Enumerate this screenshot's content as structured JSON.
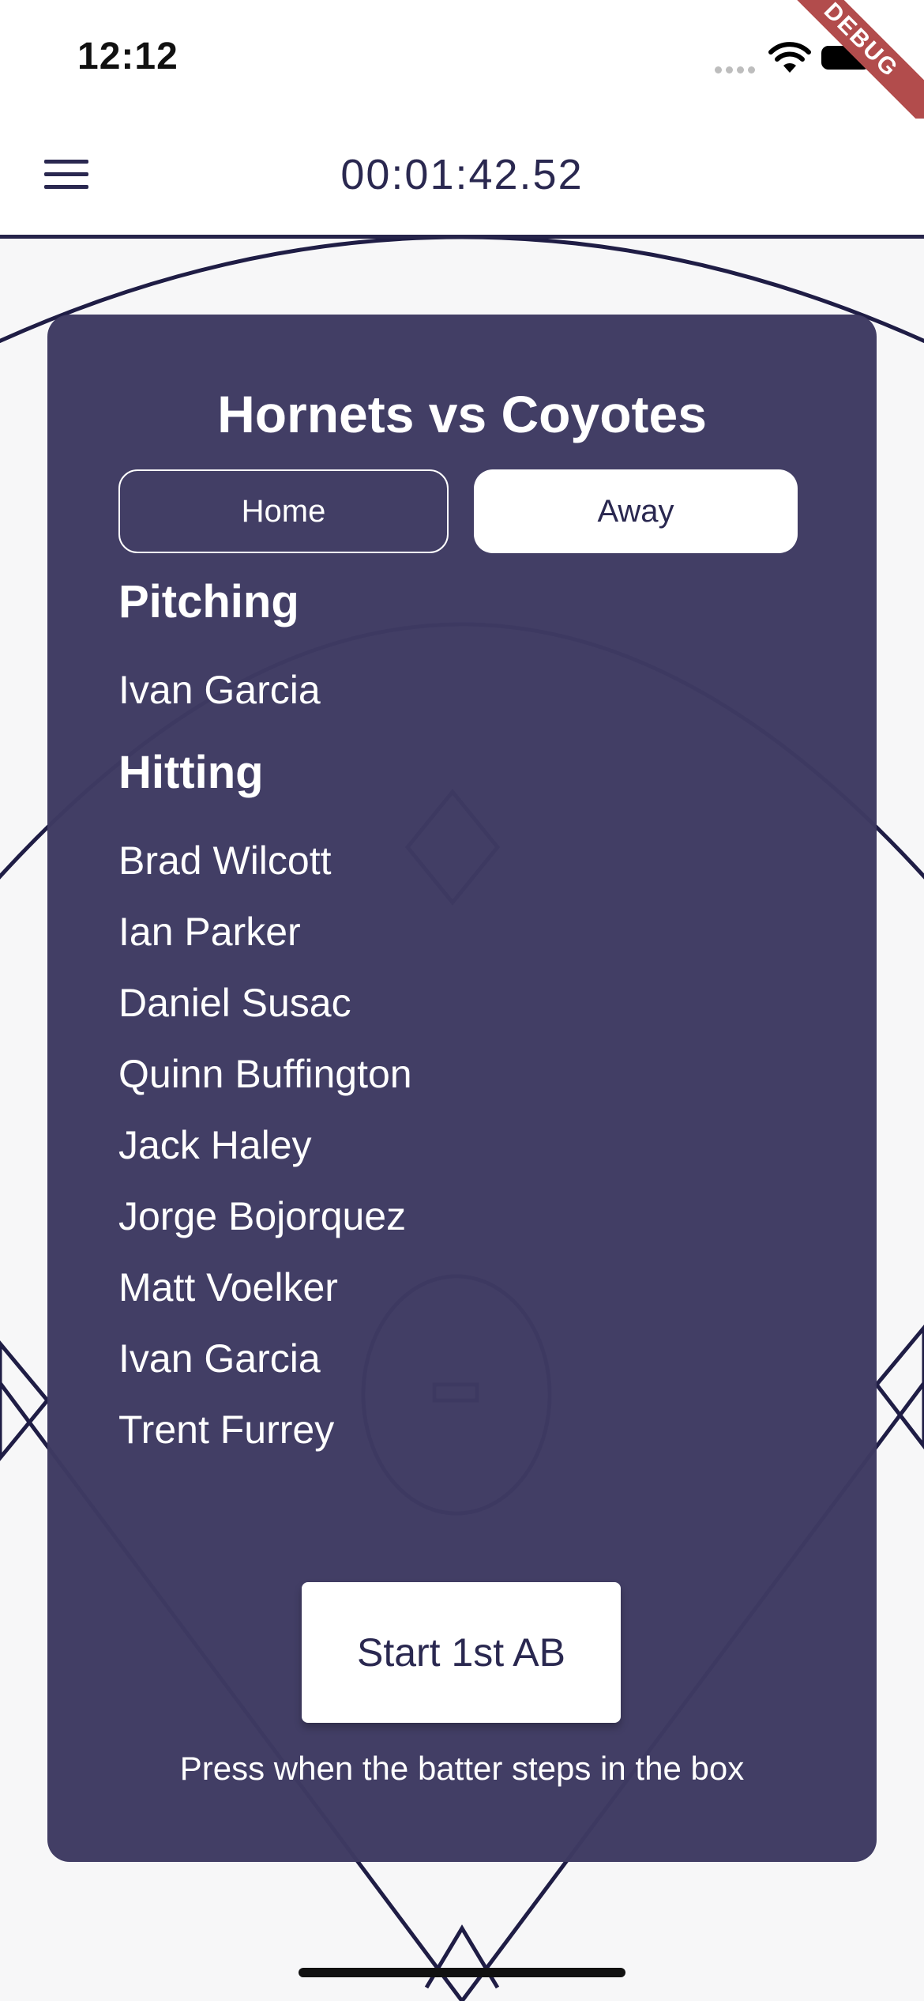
{
  "status_bar": {
    "time": "12:12"
  },
  "debug_label": "DEBUG",
  "app_bar": {
    "timer": "00:01:42.52"
  },
  "card": {
    "title": "Hornets vs Coyotes",
    "tabs": [
      {
        "label": "Home",
        "selected": false
      },
      {
        "label": "Away",
        "selected": true
      }
    ],
    "pitching_heading": "Pitching",
    "pitchers": [
      "Ivan Garcia"
    ],
    "hitting_heading": "Hitting",
    "hitters": [
      "Brad Wilcott",
      "Ian Parker",
      "Daniel Susac",
      "Quinn Buffington",
      "Jack Haley",
      "Jorge Bojorquez",
      "Matt Voelker",
      "Ivan Garcia",
      "Trent Furrey"
    ],
    "start_button_label": "Start 1st AB",
    "hint": "Press when the batter steps in the box"
  },
  "colors": {
    "card": "#3e3a62",
    "field_lines": "#1f1d45",
    "accent": "#2a2850"
  }
}
